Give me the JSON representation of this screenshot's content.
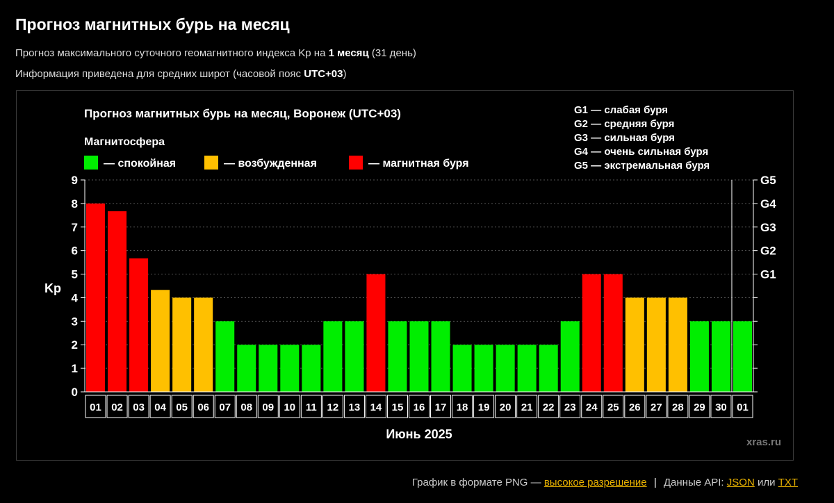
{
  "page": {
    "title": "Прогноз магнитных бурь на месяц",
    "info1_prefix": "Прогноз максимального суточного геомагнитного индекса Kp на ",
    "info1_bold": "1 месяц",
    "info1_suffix": " (31 день)",
    "info2_prefix": "Информация приведена для средних широт (часовой пояс ",
    "info2_bold": "UTC+03",
    "info2_suffix": ")"
  },
  "footer": {
    "png_prefix": "График в формате PNG —",
    "png_link": "высокое разрешение",
    "separator": "|",
    "api_prefix": "Данные API:",
    "json_link": "JSON",
    "or": "или",
    "txt_link": "TXT"
  },
  "colors": {
    "calm": "#00ee00",
    "excited": "#ffc000",
    "storm": "#ff0000",
    "background": "#000000"
  },
  "chart_data": {
    "type": "bar",
    "title": "Прогноз магнитных бурь на месяц, Воронеж (UTC+03)",
    "ylabel": "Kp",
    "xlabel": "Июнь 2025",
    "watermark": "xras.ru",
    "ylim": [
      0,
      9
    ],
    "yticks": [
      "0",
      "1",
      "2",
      "3",
      "4",
      "5",
      "6",
      "7",
      "8",
      "9"
    ],
    "grid": true,
    "legend_title": "Магнитосфера",
    "legend": [
      {
        "label": "— спокойная",
        "color": "#00ee00"
      },
      {
        "label": "— возбужденная",
        "color": "#ffc000"
      },
      {
        "label": "— магнитная буря",
        "color": "#ff0000"
      }
    ],
    "storm_scale": [
      "G1 — слабая буря",
      "G2 — средняя буря",
      "G3 — сильная буря",
      "G4 — очень сильная буря",
      "G5 — экстремальная буря"
    ],
    "right_axis": [
      {
        "label": "G1",
        "kp": 5
      },
      {
        "label": "G2",
        "kp": 6
      },
      {
        "label": "G3",
        "kp": 7
      },
      {
        "label": "G4",
        "kp": 8
      },
      {
        "label": "G5",
        "kp": 9
      }
    ],
    "categories": [
      "01",
      "02",
      "03",
      "04",
      "05",
      "06",
      "07",
      "08",
      "09",
      "10",
      "11",
      "12",
      "13",
      "14",
      "15",
      "16",
      "17",
      "18",
      "19",
      "20",
      "21",
      "22",
      "23",
      "24",
      "25",
      "26",
      "27",
      "28",
      "29",
      "30",
      "01"
    ],
    "values": [
      8,
      7.67,
      5.67,
      4.33,
      4,
      4,
      3,
      2,
      2,
      2,
      2,
      3,
      3,
      5,
      3,
      3,
      3,
      2,
      2,
      2,
      2,
      2,
      3,
      5,
      5,
      4,
      4,
      4,
      3,
      3,
      3
    ],
    "status": [
      "storm",
      "storm",
      "storm",
      "excited",
      "excited",
      "excited",
      "calm",
      "calm",
      "calm",
      "calm",
      "calm",
      "calm",
      "calm",
      "storm",
      "calm",
      "calm",
      "calm",
      "calm",
      "calm",
      "calm",
      "calm",
      "calm",
      "calm",
      "storm",
      "storm",
      "excited",
      "excited",
      "excited",
      "calm",
      "calm",
      "calm"
    ]
  }
}
